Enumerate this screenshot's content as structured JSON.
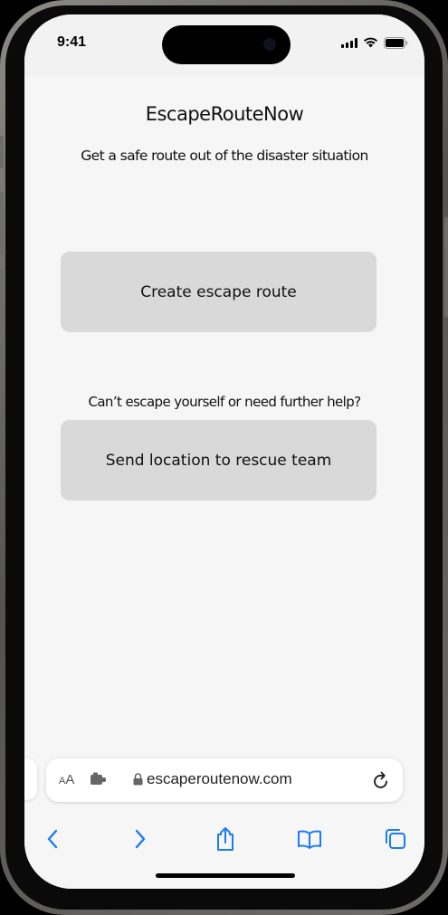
{
  "status_bar": {
    "time": "9:41"
  },
  "app": {
    "title": "EscapeRouteNow",
    "subtitle": "Get a safe route out of the disaster situation",
    "create_route_label": "Create escape route",
    "help_prompt": "Can’t escape yourself or need further help?",
    "send_location_label": "Send location to rescue team"
  },
  "browser": {
    "text_size_label_small": "A",
    "text_size_label_large": "A",
    "url": "escaperoutenow.com"
  },
  "colors": {
    "accent": "#1a7cf5",
    "button_bg": "#d9d9d9",
    "page_bg": "#f6f6f6"
  },
  "icons": [
    "signal-icon",
    "wifi-icon",
    "battery-icon",
    "extension-icon",
    "lock-icon",
    "reload-icon",
    "back-icon",
    "forward-icon",
    "share-icon",
    "bookmarks-icon",
    "tabs-icon"
  ]
}
